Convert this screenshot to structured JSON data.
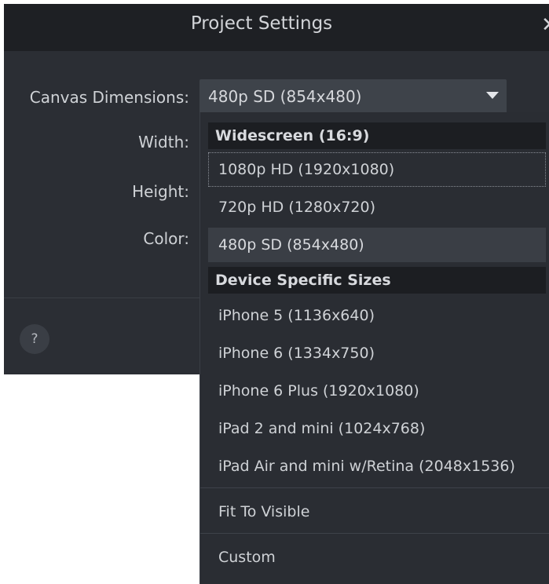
{
  "dialog": {
    "title": "Project Settings",
    "close_glyph": "✕",
    "help_glyph": "?"
  },
  "form": {
    "canvas_label": "Canvas Dimensions:",
    "width_label": "Width:",
    "height_label": "Height:",
    "color_label": "Color:",
    "canvas_value": "480p SD (854x480)"
  },
  "dropdown": {
    "groups": [
      {
        "header": "Widescreen (16:9)",
        "items": [
          {
            "label": "1080p HD (1920x1080)",
            "focused": true
          },
          {
            "label": "720p HD (1280x720)"
          },
          {
            "label": "480p SD (854x480)",
            "selected": true
          }
        ]
      },
      {
        "header": "Device Specific Sizes",
        "items": [
          {
            "label": "iPhone 5 (1136x640)"
          },
          {
            "label": "iPhone 6 (1334x750)"
          },
          {
            "label": "iPhone 6 Plus (1920x1080)"
          },
          {
            "label": "iPad 2 and mini (1024x768)"
          },
          {
            "label": "iPad Air and mini w/Retina (2048x1536)"
          }
        ]
      }
    ],
    "extra_items": [
      "Fit To Visible",
      "Custom"
    ]
  },
  "colors": {
    "dialog_bg": "#2b2e34",
    "titlebar_bg": "#1e2024",
    "combo_bg": "#3e434a",
    "menu_bg": "#2a2d33",
    "group_header_bg": "#1c1e22",
    "selected_bg": "#3a3e45",
    "text": "#cfd2d6"
  }
}
